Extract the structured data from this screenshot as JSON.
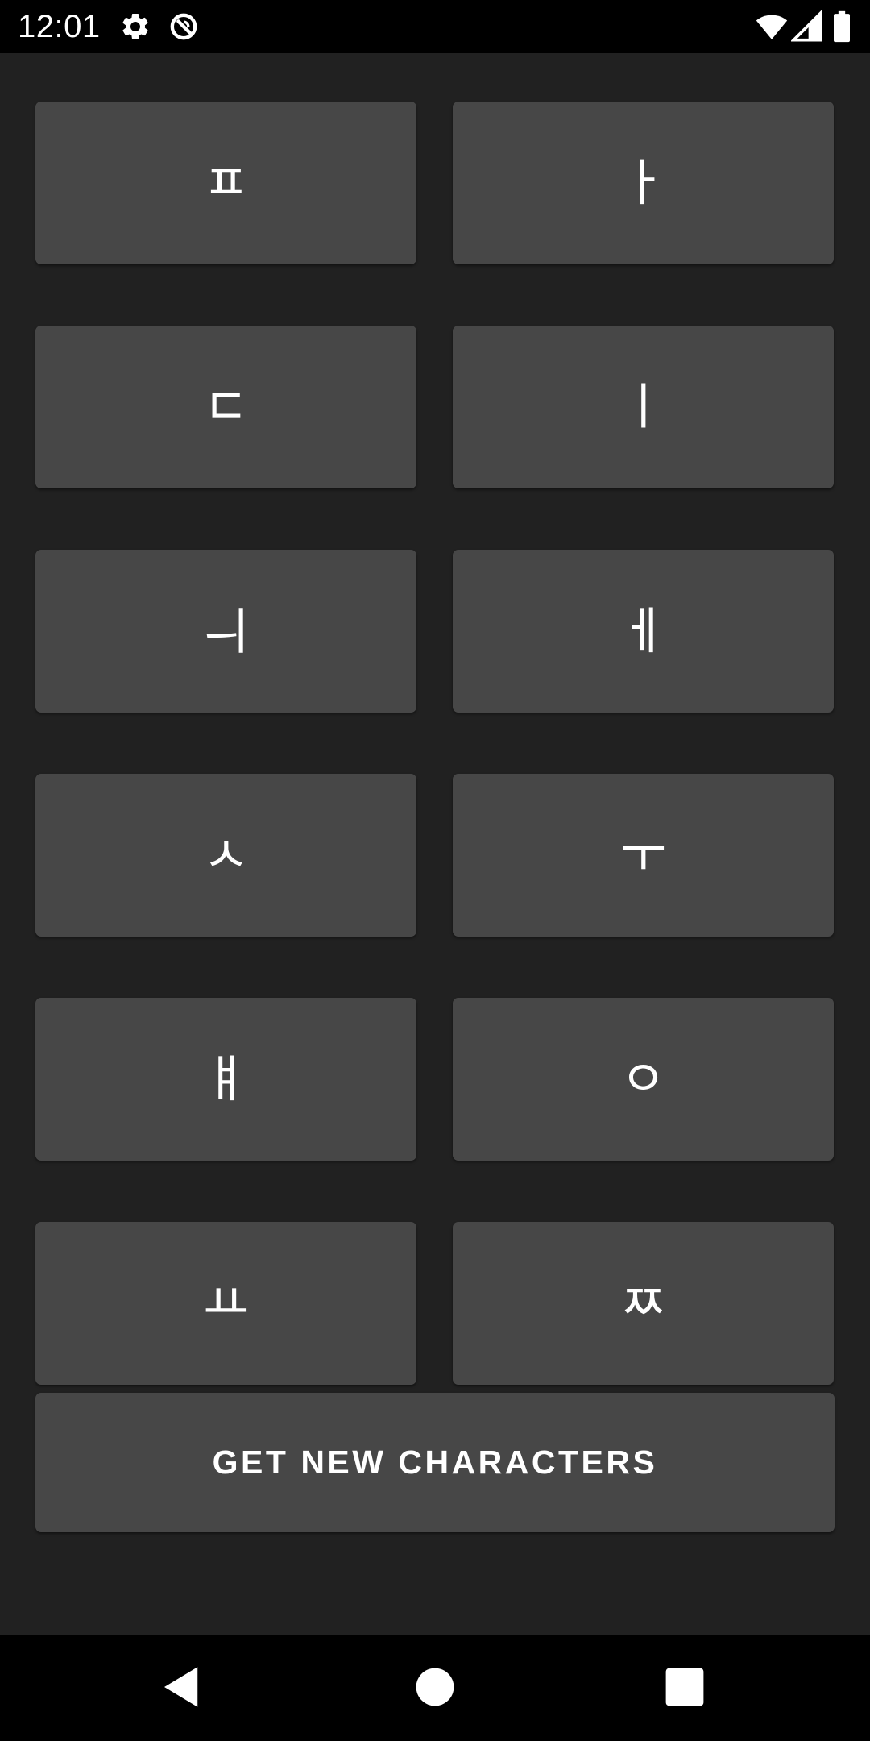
{
  "status_bar": {
    "time": "12:01",
    "icons": [
      "gear-icon",
      "data-saver-icon",
      "wifi-icon",
      "cell-signal-icon",
      "battery-icon"
    ]
  },
  "characters": [
    {
      "label": "ㅍ"
    },
    {
      "label": "ㅏ"
    },
    {
      "label": "ㄷ"
    },
    {
      "label": "ㅣ"
    },
    {
      "label": "ㅢ"
    },
    {
      "label": "ㅔ"
    },
    {
      "label": "ㅅ"
    },
    {
      "label": "ㅜ"
    },
    {
      "label": "ㅒ"
    },
    {
      "label": "ㅇ"
    },
    {
      "label": "ㅛ"
    },
    {
      "label": "ㅉ"
    }
  ],
  "get_new_button": {
    "label": "GET NEW CHARACTERS"
  },
  "nav_bar": {
    "icons": [
      "back-icon",
      "home-icon",
      "recents-icon"
    ]
  },
  "colors": {
    "background": "#212121",
    "button": "#474747",
    "text": "#ffffff",
    "system_bars": "#000000"
  }
}
